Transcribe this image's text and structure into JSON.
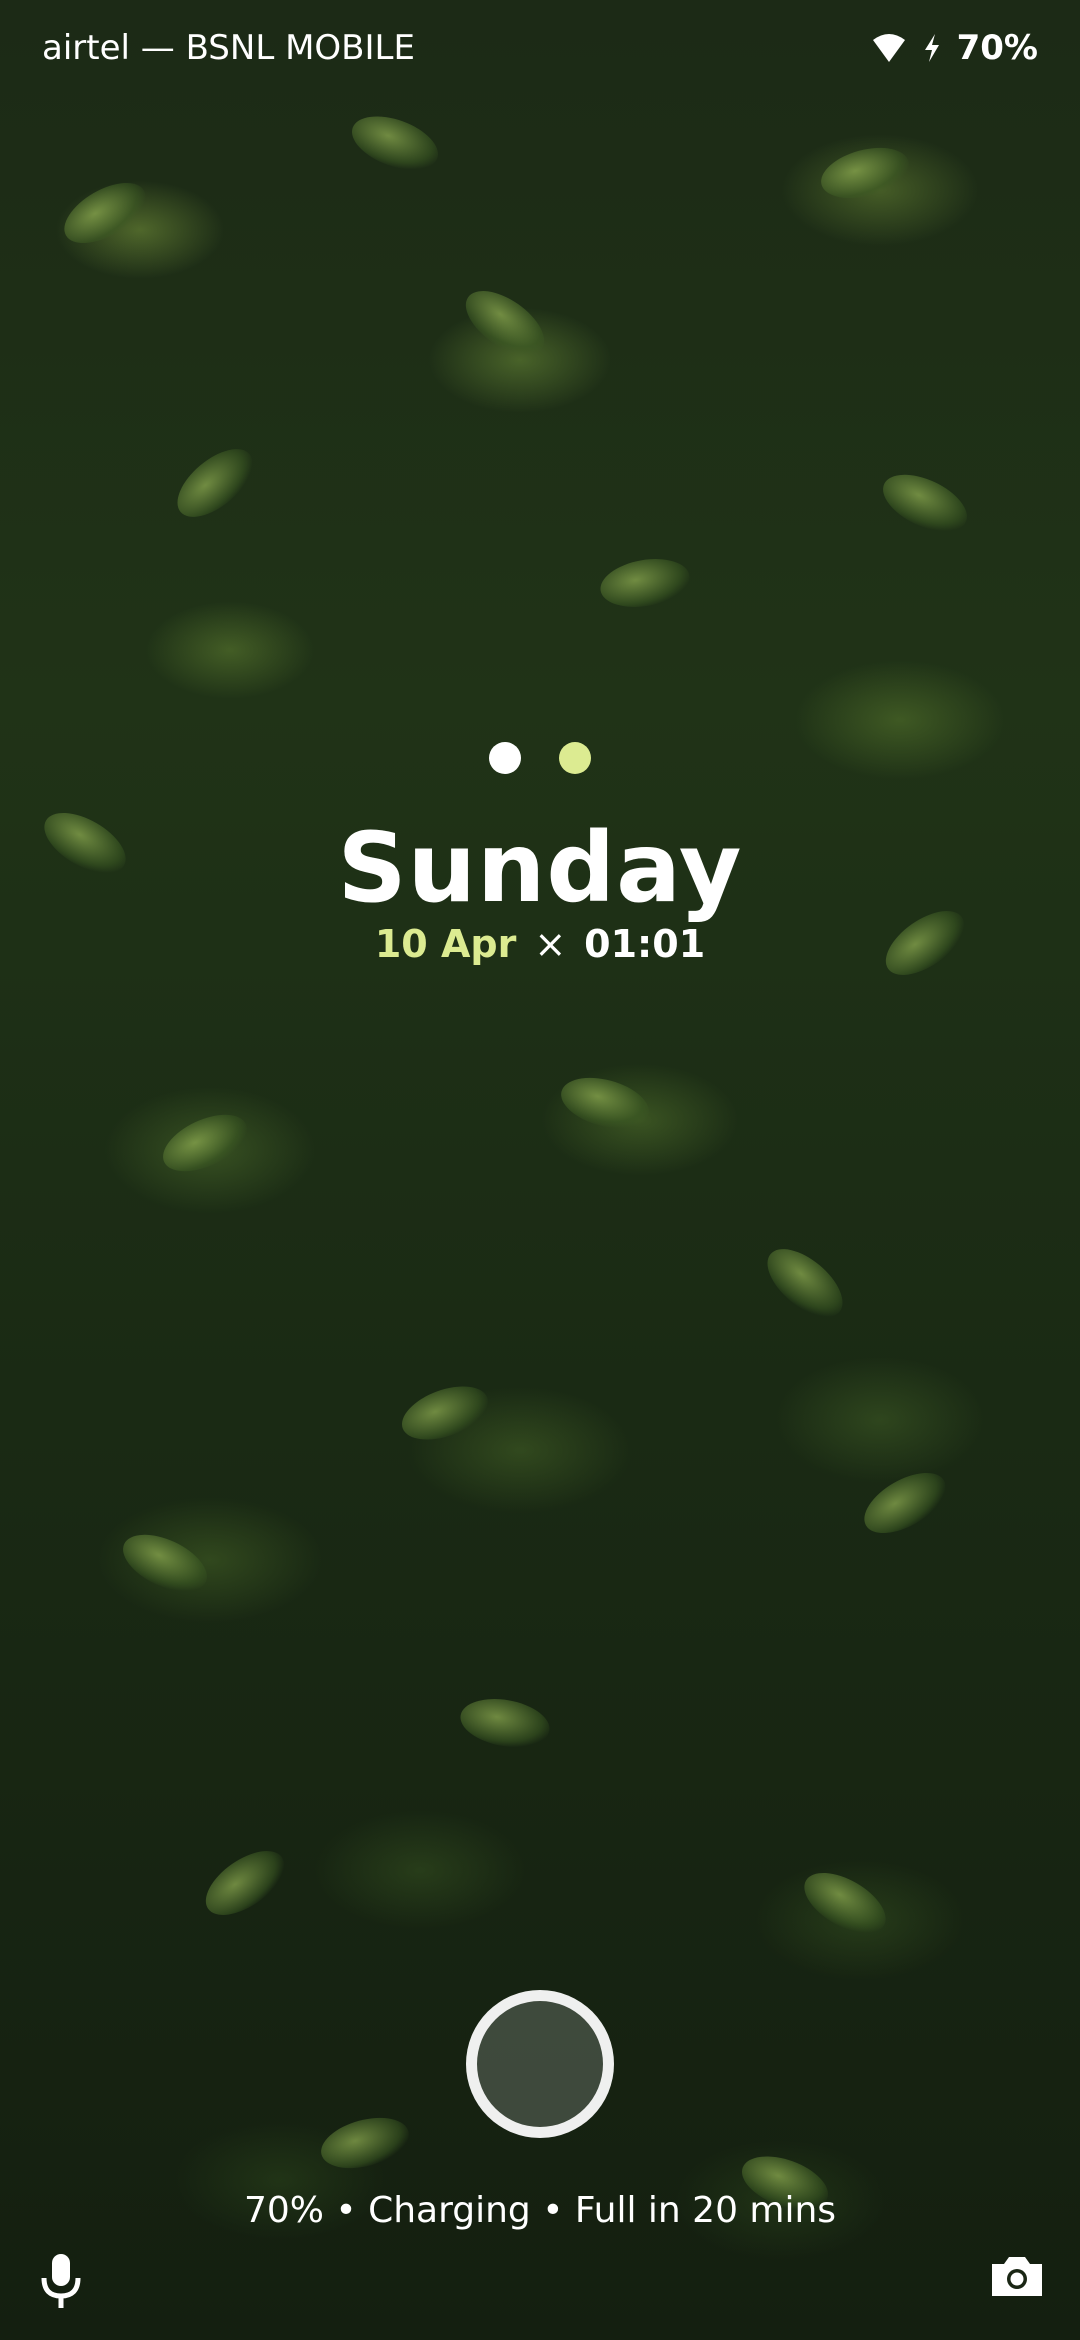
{
  "status_bar": {
    "carrier": "airtel — BSNL MOBILE",
    "battery": "70%",
    "icons": [
      "wifi-icon",
      "charging-bolt-icon"
    ]
  },
  "pager": {
    "pages": 2,
    "active_index": 0
  },
  "lockscreen": {
    "day": "Sunday",
    "date": "10 Apr",
    "separator": "×",
    "time": "01:01",
    "accent_color": "#dceb91"
  },
  "bottom": {
    "charging_text": "70% • Charging • Full in 20 mins",
    "left_shortcut": "microphone-icon",
    "right_shortcut": "camera-icon",
    "center": "fingerprint-icon"
  }
}
